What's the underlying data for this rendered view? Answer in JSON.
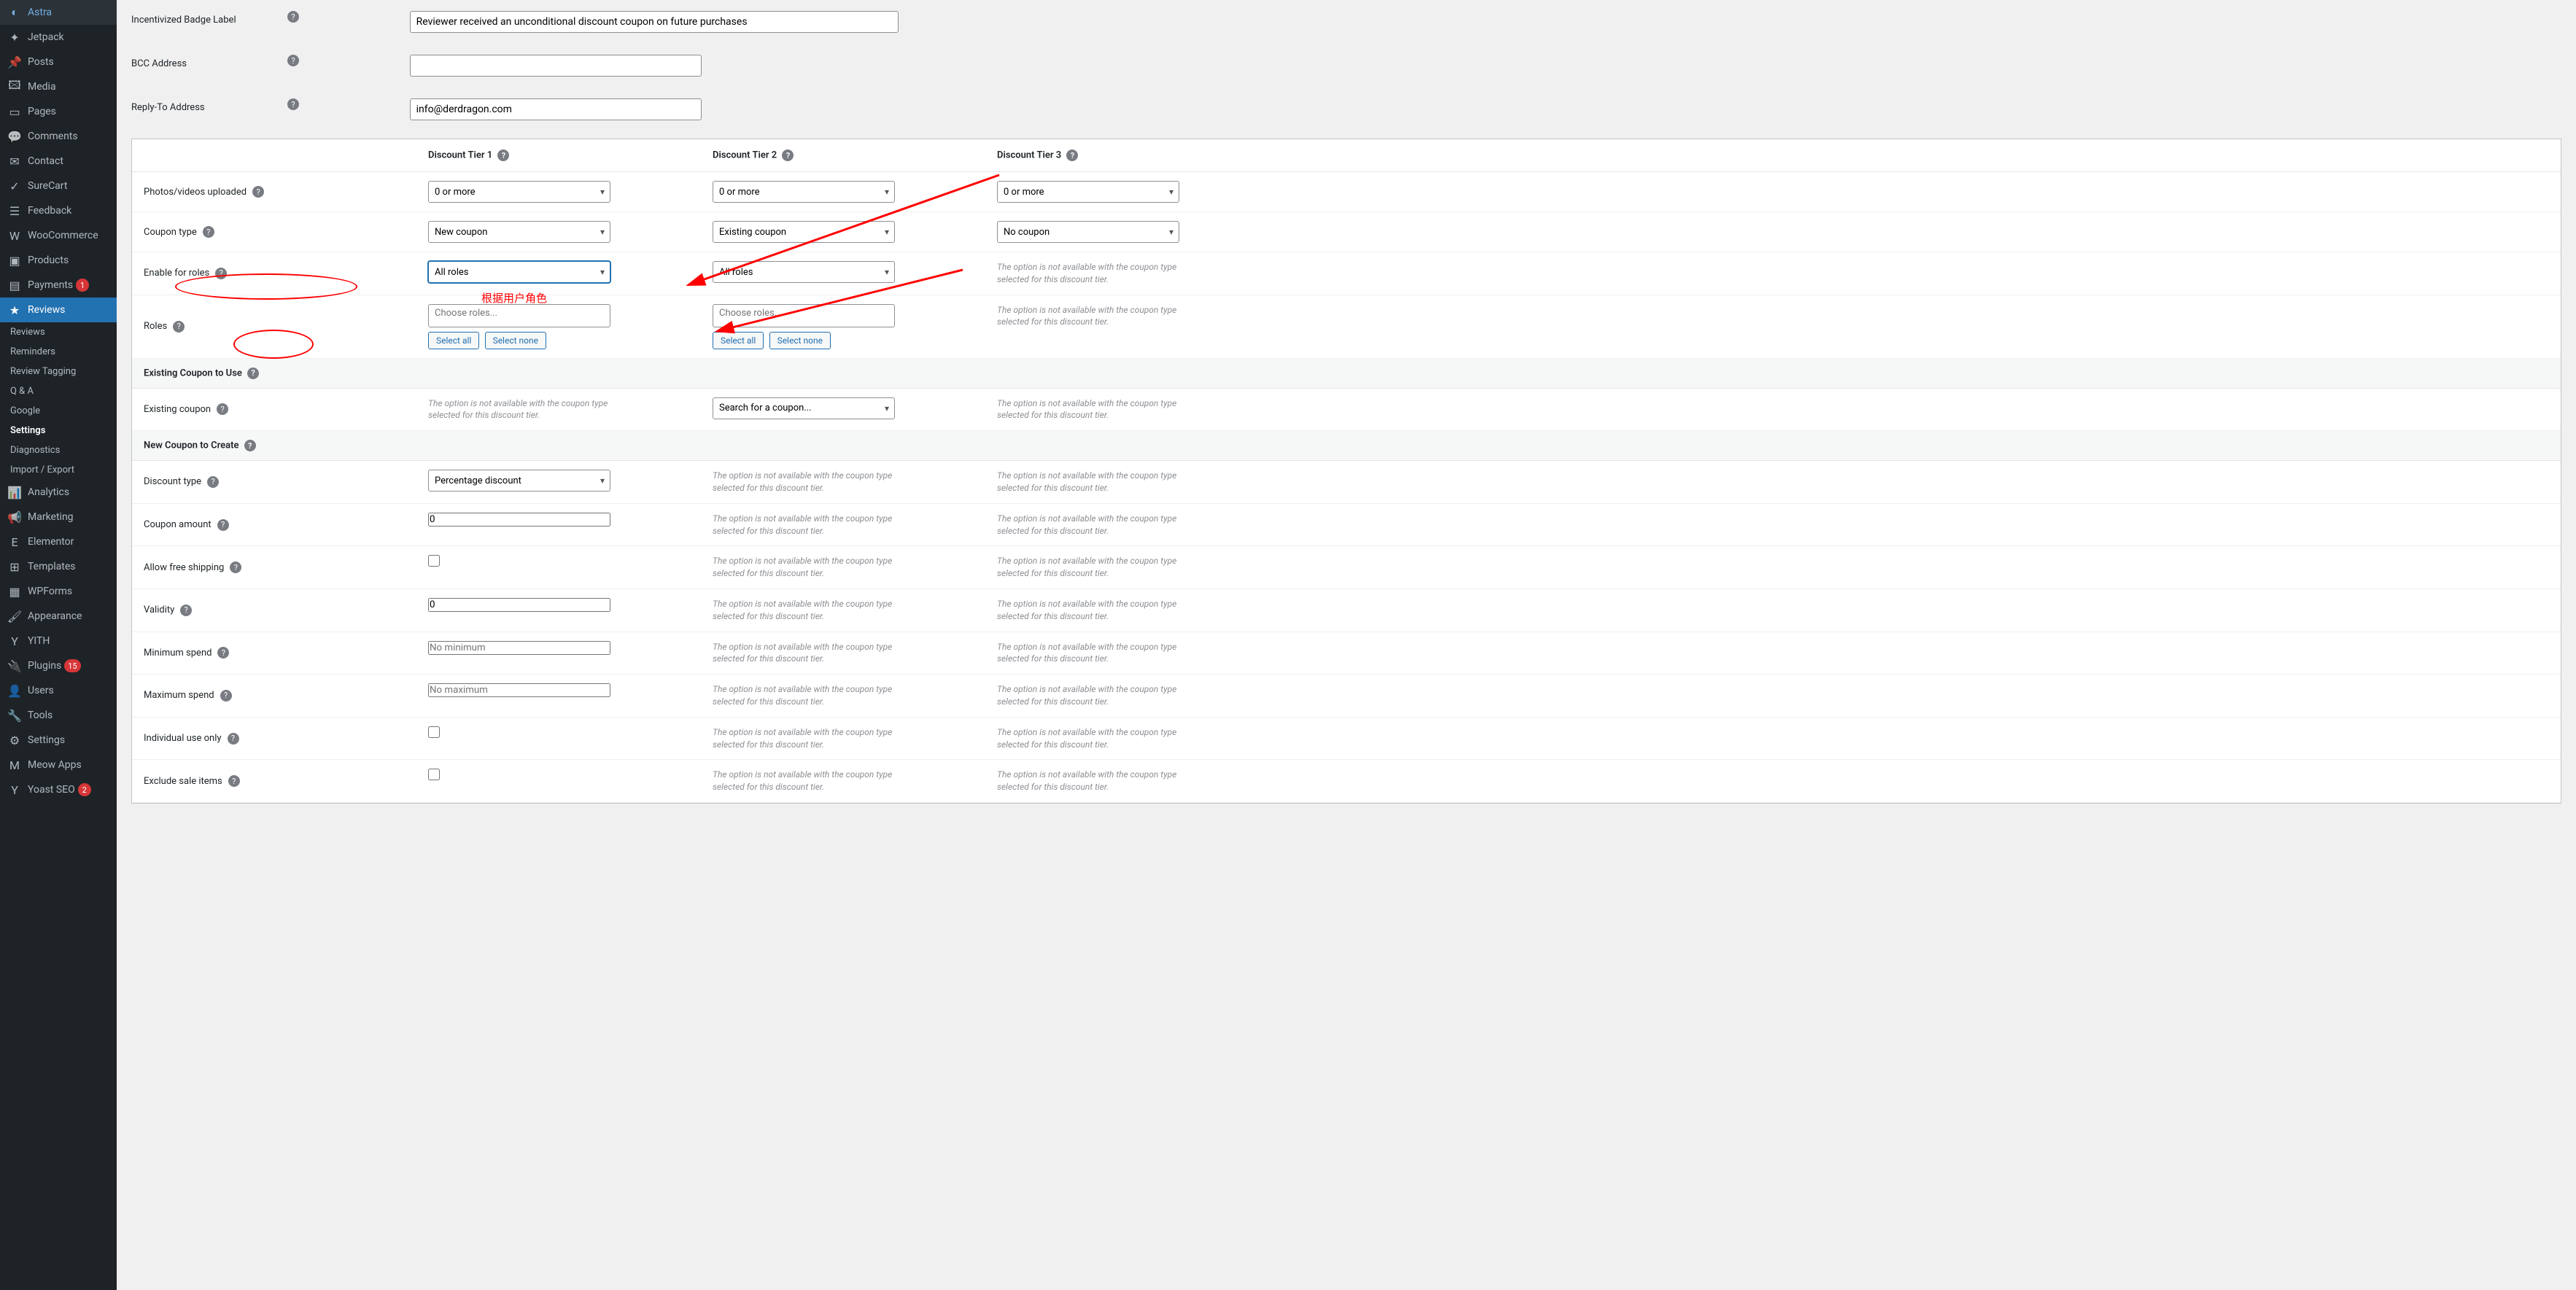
{
  "sidebar": {
    "items": [
      {
        "icon": "◐",
        "label": "Astra"
      },
      {
        "icon": "✦",
        "label": "Jetpack"
      },
      {
        "icon": "📌",
        "label": "Posts"
      },
      {
        "icon": "🖾",
        "label": "Media"
      },
      {
        "icon": "▭",
        "label": "Pages"
      },
      {
        "icon": "💬",
        "label": "Comments"
      },
      {
        "icon": "✉",
        "label": "Contact"
      },
      {
        "icon": "✓",
        "label": "SureCart"
      },
      {
        "icon": "☰",
        "label": "Feedback"
      },
      {
        "icon": "W",
        "label": "WooCommerce"
      },
      {
        "icon": "▣",
        "label": "Products"
      },
      {
        "icon": "▤",
        "label": "Payments",
        "badge": "1"
      },
      {
        "icon": "★",
        "label": "Reviews",
        "active": true
      }
    ],
    "sub": [
      {
        "label": "Reviews"
      },
      {
        "label": "Reminders"
      },
      {
        "label": "Review Tagging"
      },
      {
        "label": "Q & A"
      },
      {
        "label": "Google"
      },
      {
        "label": "Settings",
        "active": true
      },
      {
        "label": "Diagnostics"
      },
      {
        "label": "Import / Export"
      }
    ],
    "items2": [
      {
        "icon": "📊",
        "label": "Analytics"
      },
      {
        "icon": "📢",
        "label": "Marketing"
      },
      {
        "icon": "E",
        "label": "Elementor"
      },
      {
        "icon": "⊞",
        "label": "Templates"
      },
      {
        "icon": "▦",
        "label": "WPForms"
      },
      {
        "icon": "🖌",
        "label": "Appearance"
      },
      {
        "icon": "Y",
        "label": "YITH"
      },
      {
        "icon": "🔌",
        "label": "Plugins",
        "badge": "15"
      },
      {
        "icon": "👤",
        "label": "Users"
      },
      {
        "icon": "🔧",
        "label": "Tools"
      },
      {
        "icon": "⚙",
        "label": "Settings"
      },
      {
        "icon": "M",
        "label": "Meow Apps"
      },
      {
        "icon": "Y",
        "label": "Yoast SEO",
        "badge": "2"
      }
    ]
  },
  "top_form": {
    "badge_label": "Incentivized Badge Label",
    "badge_value": "Reviewer received an unconditional discount coupon on future purchases",
    "bcc_label": "BCC Address",
    "bcc_value": "",
    "reply_label": "Reply-To Address",
    "reply_value": "info@derdragon.com"
  },
  "tiers": {
    "t1": "Discount Tier 1",
    "t2": "Discount Tier 2",
    "t3": "Discount Tier 3"
  },
  "rows": {
    "photos": {
      "label": "Photos/videos uploaded",
      "v": "0 or more"
    },
    "coupon_type": {
      "label": "Coupon type",
      "v1": "New coupon",
      "v2": "Existing coupon",
      "v3": "No coupon"
    },
    "enable_roles": {
      "label": "Enable for roles",
      "v": "All roles"
    },
    "roles": {
      "label": "Roles",
      "placeholder": "Choose roles...",
      "sa": "Select all",
      "sn": "Select none"
    },
    "existing_hdr": "Existing Coupon to Use",
    "existing_coupon": {
      "label": "Existing coupon",
      "search": "Search for a coupon..."
    },
    "new_hdr": "New Coupon to Create",
    "discount_type": {
      "label": "Discount type",
      "v": "Percentage discount"
    },
    "coupon_amount": {
      "label": "Coupon amount",
      "v": "0"
    },
    "free_ship": {
      "label": "Allow free shipping"
    },
    "validity": {
      "label": "Validity",
      "v": "0"
    },
    "min_spend": {
      "label": "Minimum spend",
      "ph": "No minimum"
    },
    "max_spend": {
      "label": "Maximum spend",
      "ph": "No maximum"
    },
    "individual": {
      "label": "Individual use only"
    },
    "exclude_sale": {
      "label": "Exclude sale items"
    }
  },
  "na_text": "The option is not available with the coupon type selected for this discount tier.",
  "annot_text": "根据用户角色"
}
